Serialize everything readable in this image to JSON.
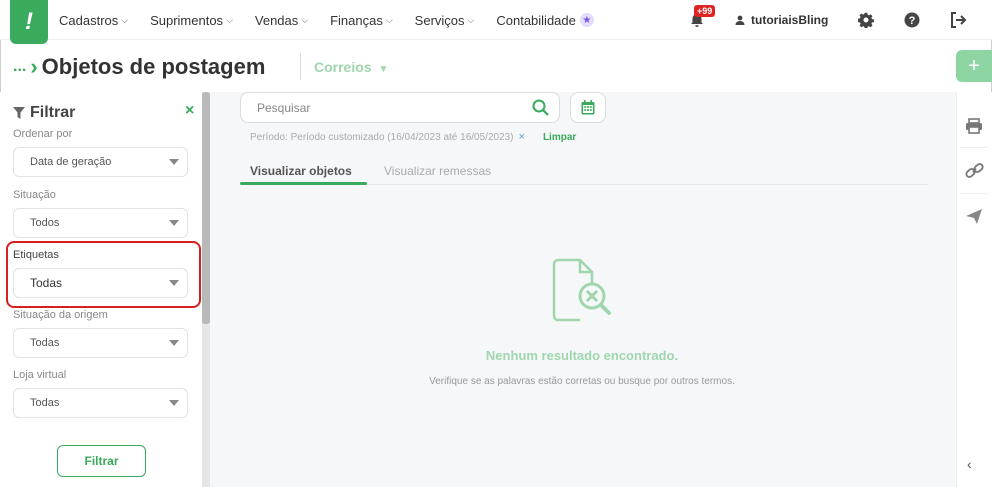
{
  "nav": {
    "logo": "!",
    "items": [
      "Cadastros",
      "Suprimentos",
      "Vendas",
      "Finanças",
      "Serviços",
      "Contabilidade"
    ],
    "notifications_badge": "+99",
    "user": "tutoriaisBling"
  },
  "header": {
    "dots": "...",
    "title": "Objetos de postagem",
    "carrier": "Correios"
  },
  "filter": {
    "title": "Filtrar",
    "close": "×",
    "order_label": "Ordenar por",
    "order_value": "Data de geração",
    "status_label": "Situação",
    "status_value": "Todos",
    "labels_label": "Etiquetas",
    "labels_value": "Todas",
    "origin_label": "Situação da origem",
    "origin_value": "Todas",
    "store_label": "Loja virtual",
    "store_value": "Todas",
    "button": "Filtrar"
  },
  "search": {
    "placeholder": "Pesquisar"
  },
  "period": {
    "text": "Período: Período customizado (16/04/2023 até 16/05/2023)",
    "remove": "×",
    "clear": "Limpar"
  },
  "tabs": {
    "objects": "Visualizar objetos",
    "shipments": "Visualizar remessas"
  },
  "empty": {
    "title": "Nenhum resultado encontrado.",
    "subtitle": "Verifique se as palavras estão corretas ou busque por outros termos."
  },
  "actions": {
    "add": "+",
    "back": "‹"
  },
  "colors": {
    "brand_green": "#3aaa5c",
    "highlight_red": "#d61f1f",
    "badge_red": "#e02424"
  }
}
